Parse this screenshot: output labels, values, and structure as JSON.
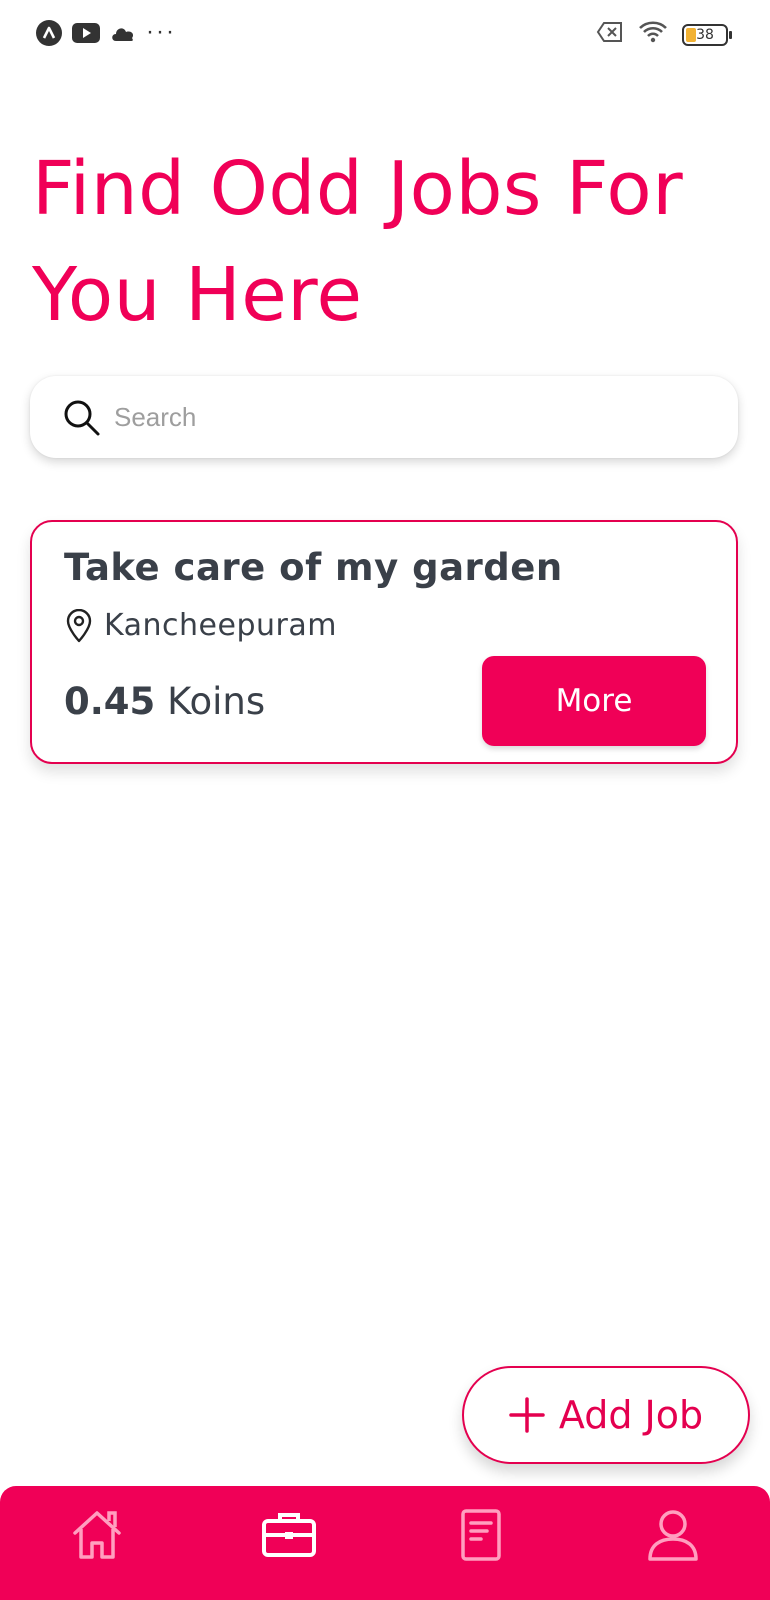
{
  "status_bar": {
    "icons": [
      "app-a-icon",
      "youtube-icon",
      "cloud-icon",
      "more-dots-icon",
      "sim-none-icon",
      "wifi-icon",
      "battery-icon"
    ],
    "dots": "···",
    "battery_level": "38"
  },
  "headline": "Find Odd Jobs For You Here",
  "search": {
    "placeholder": "Search",
    "value": ""
  },
  "jobs": [
    {
      "title": "Take care of my garden",
      "location": "Kancheepuram",
      "amount": "0.45",
      "currency": "Koins",
      "action_label": "More"
    }
  ],
  "add_job_label": "Add Job",
  "bottom_nav": {
    "items": [
      {
        "name": "home",
        "icon": "home-icon",
        "active": false
      },
      {
        "name": "jobs",
        "icon": "briefcase-icon",
        "active": true
      },
      {
        "name": "documents",
        "icon": "document-icon",
        "active": false
      },
      {
        "name": "profile",
        "icon": "user-icon",
        "active": false
      }
    ]
  },
  "colors": {
    "accent": "#f00057",
    "text_dark": "#3a4049",
    "nav_inactive": "#ff9fbf"
  }
}
